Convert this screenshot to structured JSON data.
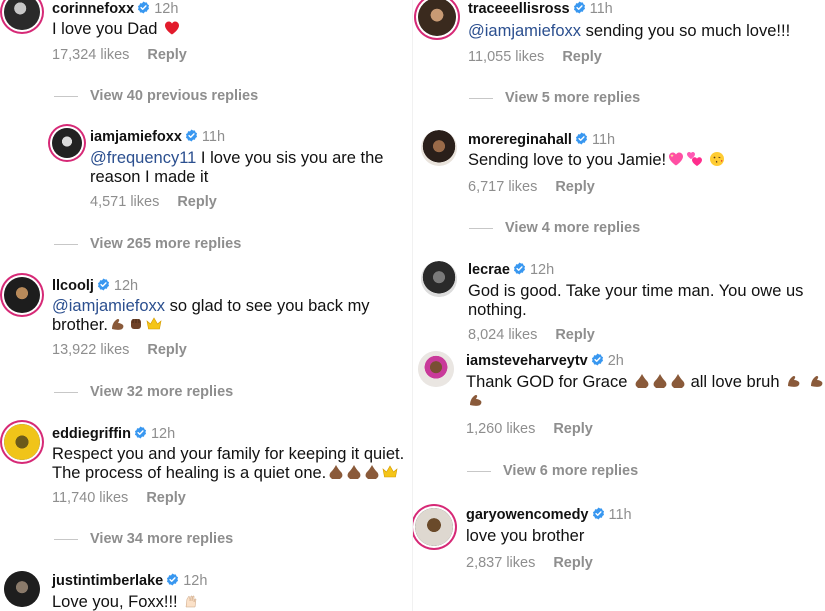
{
  "left": {
    "comments": [
      {
        "user": "corinnefoxx",
        "time": "12h",
        "text": "I love you Dad",
        "likes": "17,324 likes",
        "reply": "Reply"
      },
      {
        "user": "iamjamiefoxx",
        "time": "11h",
        "mention": "@frequency11",
        "text": " I love you sis you are the reason I made it",
        "likes": "4,571 likes",
        "reply": "Reply"
      },
      {
        "user": "llcoolj",
        "time": "12h",
        "mention": "@iamjamiefoxx",
        "text": "  so glad to see you back my brother.",
        "likes": "13,922 likes",
        "reply": "Reply"
      },
      {
        "user": "eddiegriffin",
        "time": "12h",
        "text": "Respect you and your family for keeping it quiet. The process of healing is a quiet one.",
        "likes": "11,740 likes",
        "reply": "Reply"
      },
      {
        "user": "justintimberlake",
        "time": "12h",
        "text": "Love you, Foxx!!!"
      }
    ],
    "view_more": [
      "View 40 previous replies",
      "View 265 more replies",
      "View 32 more replies",
      "View 34 more replies"
    ]
  },
  "right": {
    "comments": [
      {
        "user": "traceeellisross",
        "time": "11h",
        "mention": "@iamjamiefoxx",
        "text": " sending you so much love!!!",
        "likes": "11,055 likes",
        "reply": "Reply"
      },
      {
        "user": "morereginahall",
        "time": "11h",
        "text": "Sending love to you Jamie!",
        "likes": "6,717 likes",
        "reply": "Reply"
      },
      {
        "user": "lecrae",
        "time": "12h",
        "text": "God is good. Take your time man. You owe us nothing.",
        "likes": "8,024 likes",
        "reply": "Reply"
      },
      {
        "user": "iamsteveharveytv",
        "time": "2h",
        "text": "Thank GOD  for Grace",
        "text2": " all love bruh",
        "likes": "1,260 likes",
        "reply": "Reply"
      },
      {
        "user": "garyowencomedy",
        "time": "11h",
        "text": "love you brother",
        "likes": "2,837 likes",
        "reply": "Reply"
      }
    ],
    "view_more": [
      "View 5 more replies",
      "View 4 more replies",
      "View 6 more replies"
    ]
  },
  "colors": {
    "verified": "#3897f0",
    "story_ring": "#d62976",
    "muted": "#8e8e8e",
    "mention": "#2b4f8f"
  },
  "icons": [
    "verified-badge-icon",
    "red-heart-emoji",
    "flexed-biceps-emoji",
    "raised-fist-emoji",
    "crown-emoji",
    "folded-hands-emoji",
    "sparkling-heart-emoji",
    "two-hearts-emoji",
    "kissing-face-emoji",
    "raising-hands-emoji"
  ]
}
